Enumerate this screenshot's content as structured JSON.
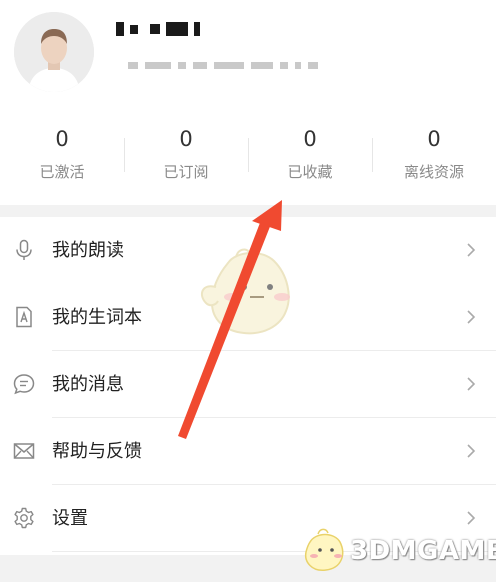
{
  "stats": [
    {
      "value": "0",
      "label": "已激活"
    },
    {
      "value": "0",
      "label": "已订阅"
    },
    {
      "value": "0",
      "label": "已收藏"
    },
    {
      "value": "0",
      "label": "离线资源"
    }
  ],
  "menu": [
    {
      "label": "我的朗读",
      "icon": "microphone-icon"
    },
    {
      "label": "我的生词本",
      "icon": "vocabulary-book-icon"
    },
    {
      "label": "我的消息",
      "icon": "message-bubble-icon"
    },
    {
      "label": "帮助与反馈",
      "icon": "envelope-icon"
    },
    {
      "label": "设置",
      "icon": "gear-icon"
    }
  ],
  "watermark": {
    "text": "3DMGAME"
  },
  "colors": {
    "annotation_arrow": "#f04a30",
    "divider": "#ececec",
    "section_gap": "#f2f2f2"
  }
}
